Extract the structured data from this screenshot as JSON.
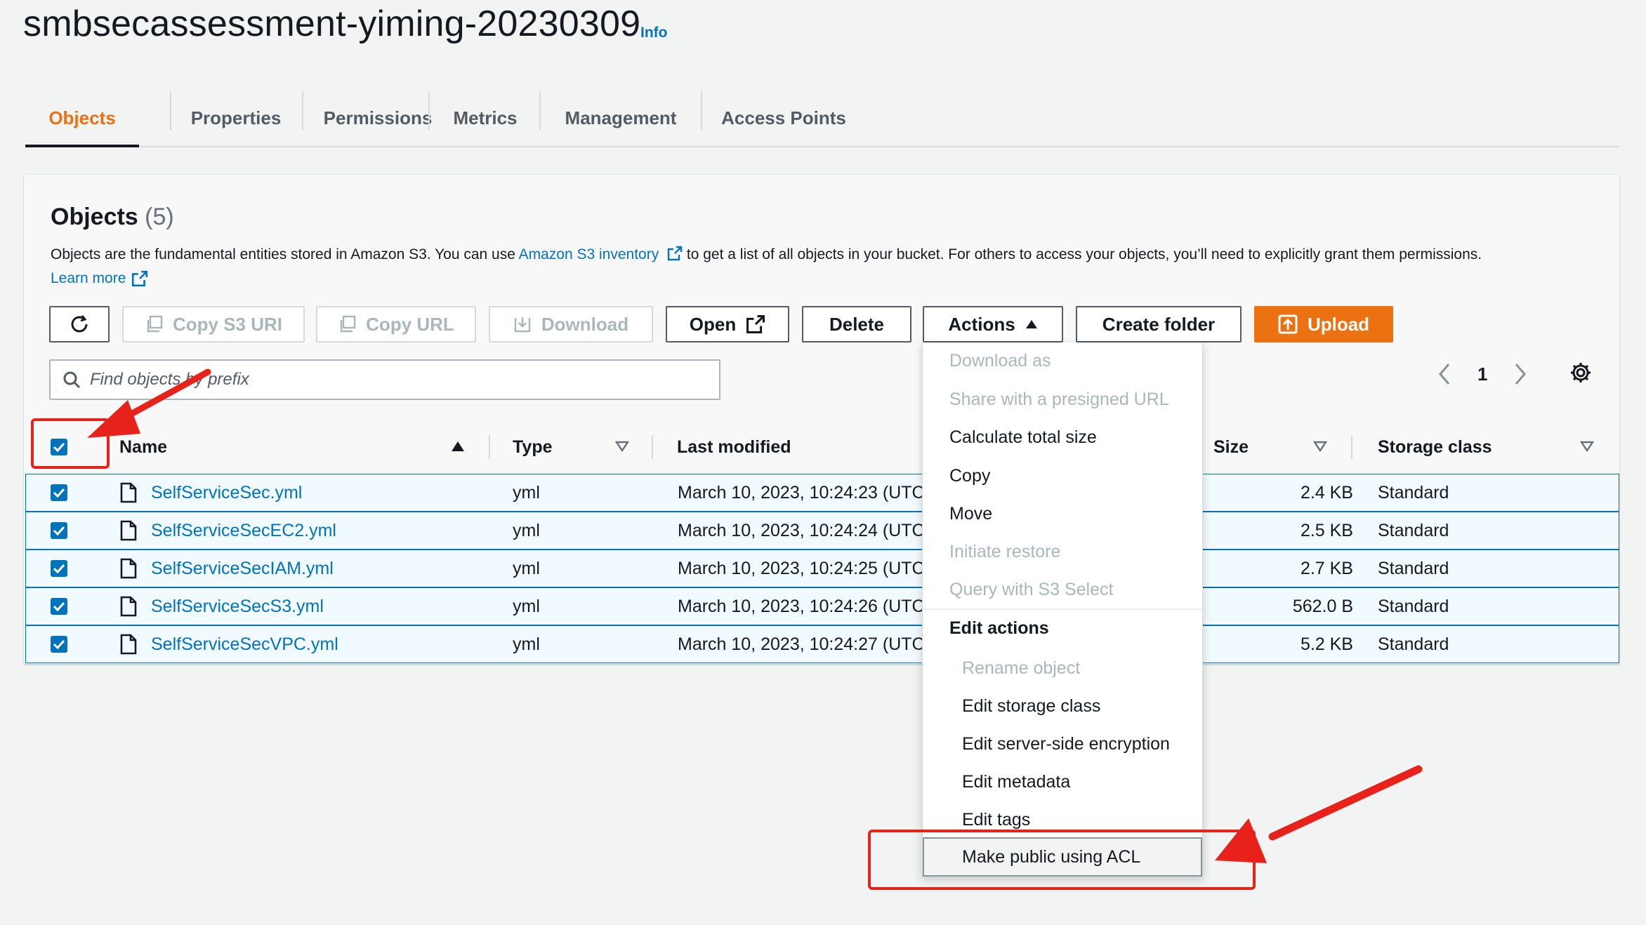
{
  "header": {
    "bucket_name": "smbsecassessment-yiming-20230309",
    "info_label": "Info"
  },
  "tabs": [
    {
      "label": "Objects",
      "active": true
    },
    {
      "label": "Properties"
    },
    {
      "label": "Permissions"
    },
    {
      "label": "Metrics"
    },
    {
      "label": "Management"
    },
    {
      "label": "Access Points"
    }
  ],
  "objects_panel": {
    "heading": "Objects",
    "count": "(5)",
    "description_before": "Objects are the fundamental entities stored in Amazon S3. You can use ",
    "inventory_link": "Amazon S3 inventory",
    "description_after": " to get a list of all objects in your bucket. For others to access your objects, you’ll need to explicitly grant them permissions.",
    "learn_more": "Learn more"
  },
  "toolbar": {
    "copy_s3_uri": "Copy S3 URI",
    "copy_url": "Copy URL",
    "download": "Download",
    "open": "Open",
    "delete": "Delete",
    "actions": "Actions",
    "create_folder": "Create folder",
    "upload": "Upload"
  },
  "search": {
    "placeholder": "Find objects by prefix"
  },
  "pagination": {
    "current_page": "1"
  },
  "table": {
    "columns": {
      "name": "Name",
      "type": "Type",
      "last_modified": "Last modified",
      "size": "Size",
      "storage_class": "Storage class"
    },
    "rows": [
      {
        "name": "SelfServiceSec.yml",
        "type": "yml",
        "last_modified": "March 10, 2023, 10:24:23 (UTC",
        "size": "2.4 KB",
        "storage_class": "Standard",
        "checked": true
      },
      {
        "name": "SelfServiceSecEC2.yml",
        "type": "yml",
        "last_modified": "March 10, 2023, 10:24:24 (UTC",
        "size": "2.5 KB",
        "storage_class": "Standard",
        "checked": true
      },
      {
        "name": "SelfServiceSecIAM.yml",
        "type": "yml",
        "last_modified": "March 10, 2023, 10:24:25 (UTC",
        "size": "2.7 KB",
        "storage_class": "Standard",
        "checked": true
      },
      {
        "name": "SelfServiceSecS3.yml",
        "type": "yml",
        "last_modified": "March 10, 2023, 10:24:26 (UTC",
        "size": "562.0 B",
        "storage_class": "Standard",
        "checked": true
      },
      {
        "name": "SelfServiceSecVPC.yml",
        "type": "yml",
        "last_modified": "March 10, 2023, 10:24:27 (UTC",
        "size": "5.2 KB",
        "storage_class": "Standard",
        "checked": true
      }
    ]
  },
  "actions_menu": {
    "items": [
      {
        "label": "Download as",
        "disabled": true
      },
      {
        "label": "Share with a presigned URL",
        "disabled": true
      },
      {
        "label": "Calculate total size",
        "disabled": false
      },
      {
        "label": "Copy",
        "disabled": false
      },
      {
        "label": "Move",
        "disabled": false
      },
      {
        "label": "Initiate restore",
        "disabled": true
      },
      {
        "label": "Query with S3 Select",
        "disabled": true
      }
    ],
    "edit_group_label": "Edit actions",
    "edit_items": [
      {
        "label": "Rename object",
        "disabled": true
      },
      {
        "label": "Edit storage class",
        "disabled": false
      },
      {
        "label": "Edit server-side encryption",
        "disabled": false
      },
      {
        "label": "Edit metadata",
        "disabled": false
      },
      {
        "label": "Edit tags",
        "disabled": false
      },
      {
        "label": "Make public using ACL",
        "disabled": false,
        "highlighted": true
      }
    ]
  },
  "colors": {
    "accent_orange": "#ec7211",
    "link_blue": "#0073bb",
    "annotation_red": "#e8221b"
  }
}
